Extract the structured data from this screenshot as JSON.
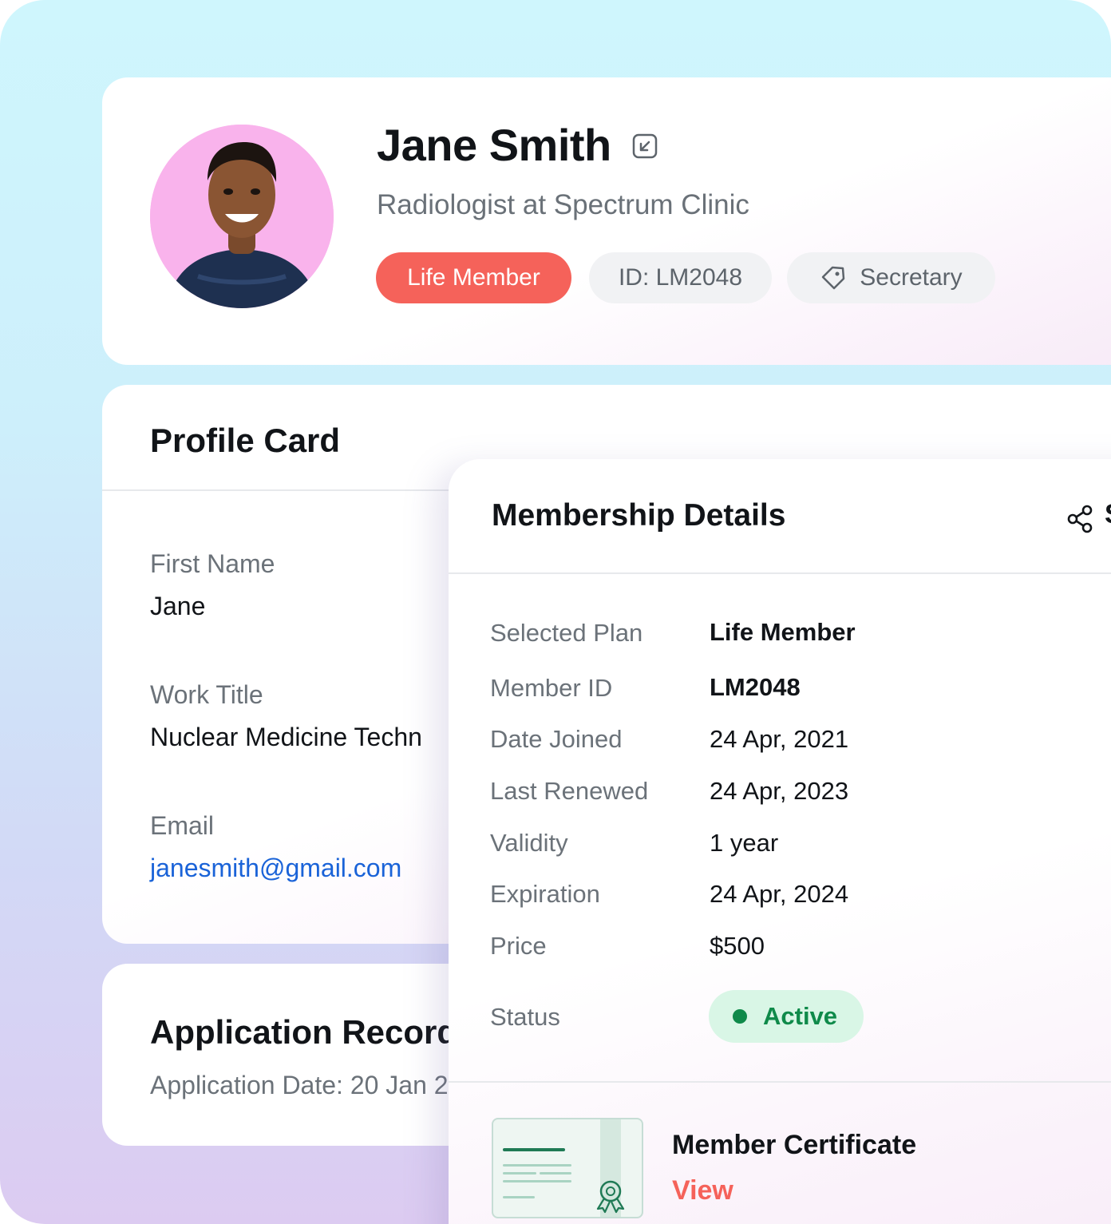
{
  "header": {
    "name": "Jane Smith",
    "subtitle": "Radiologist at Spectrum Clinic",
    "chips": {
      "plan": "Life Member",
      "id": "ID: LM2048",
      "role": "Secretary"
    }
  },
  "profile_card": {
    "title": "Profile Card",
    "fields": [
      {
        "label": "First Name",
        "value": "Jane"
      },
      {
        "label": "Work Title",
        "value": "Nuclear Medicine Techn"
      },
      {
        "label": "Email",
        "value": "janesmith@gmail.com"
      }
    ]
  },
  "application": {
    "title": "Application Record",
    "date": "Application Date: 20 Jan 2"
  },
  "membership": {
    "title": "Membership Details",
    "cut_letter": "S",
    "rows": [
      {
        "label": "Selected Plan",
        "value": "Life Member"
      },
      {
        "label": "Member ID",
        "value": "LM2048"
      },
      {
        "label": "Date Joined",
        "value": "24 Apr, 2021"
      },
      {
        "label": "Last Renewed",
        "value": "24 Apr, 2023"
      },
      {
        "label": "Validity",
        "value": "1 year"
      },
      {
        "label": "Expiration",
        "value": "24 Apr, 2024"
      },
      {
        "label": "Price",
        "value": "$500"
      }
    ],
    "status_label": "Status",
    "status_value": "Active",
    "certificate": {
      "title": "Member Certificate",
      "link": "View"
    }
  },
  "colors": {
    "accent_red": "#f5625a",
    "status_green": "#0f8a4a",
    "link_blue": "#1a63d8"
  },
  "icons": [
    "collapse-icon",
    "tag-icon",
    "share-icon",
    "certificate-award-icon"
  ]
}
